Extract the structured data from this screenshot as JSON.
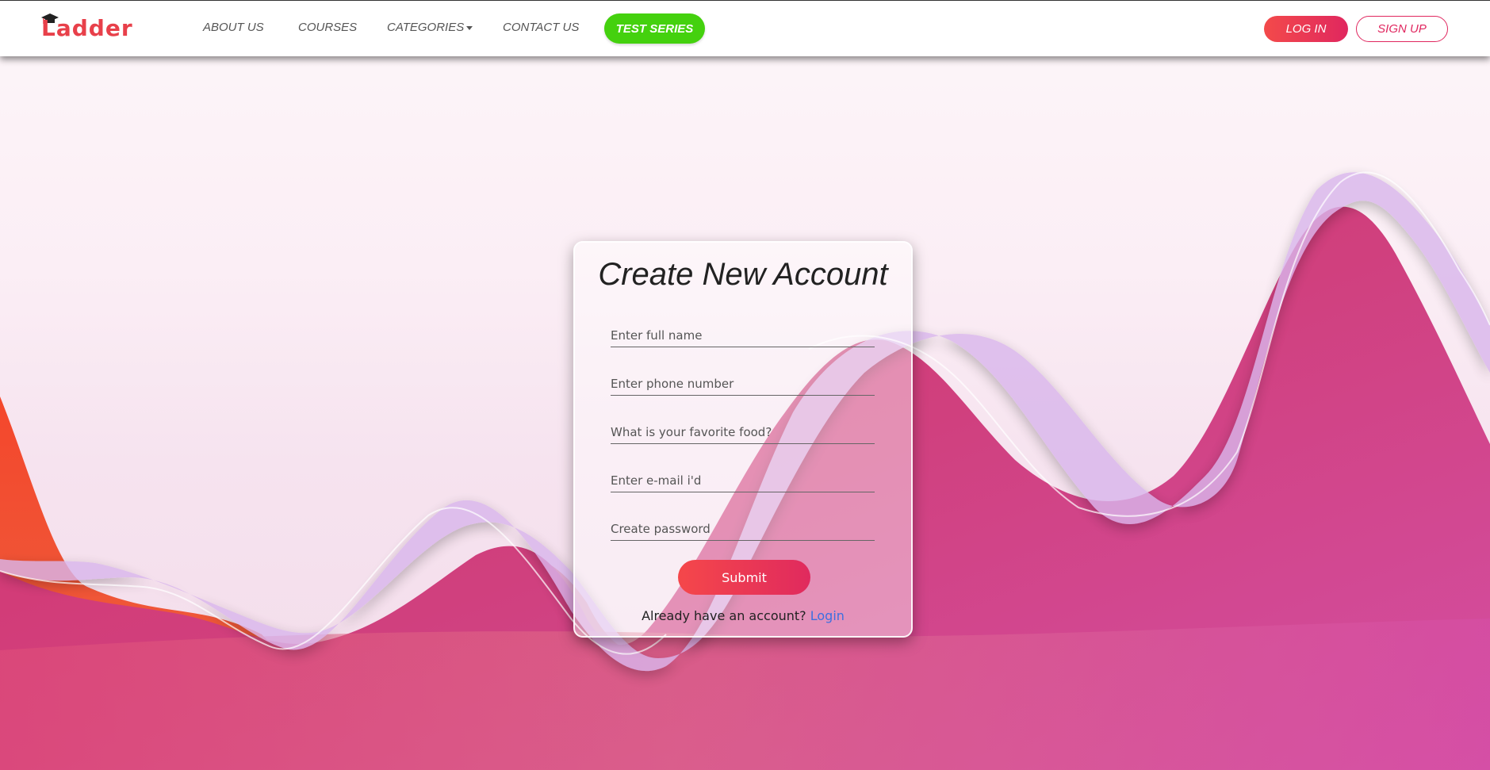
{
  "brand": {
    "name": "Ladder",
    "logo_color": "#e8404a"
  },
  "nav": {
    "about": "ABOUT US",
    "courses": "COURSES",
    "categories": "CATEGORIES",
    "contact": "CONTACT US",
    "test_series": "TEST SERIES",
    "login": "LOG IN",
    "signup": "SIGN UP"
  },
  "form": {
    "title": "Create New Account",
    "fields": [
      {
        "placeholder": "Enter full name"
      },
      {
        "placeholder": "Enter phone number"
      },
      {
        "placeholder": "What is your favorite food?"
      },
      {
        "placeholder": "Enter e-mail i'd"
      },
      {
        "placeholder": "Create password"
      }
    ],
    "submit": "Submit",
    "already_text": "Already have an account?",
    "login_link": "Login"
  },
  "colors": {
    "accent": "#e0275f",
    "test_series": "#44d10e",
    "link": "#3d6fe0"
  }
}
